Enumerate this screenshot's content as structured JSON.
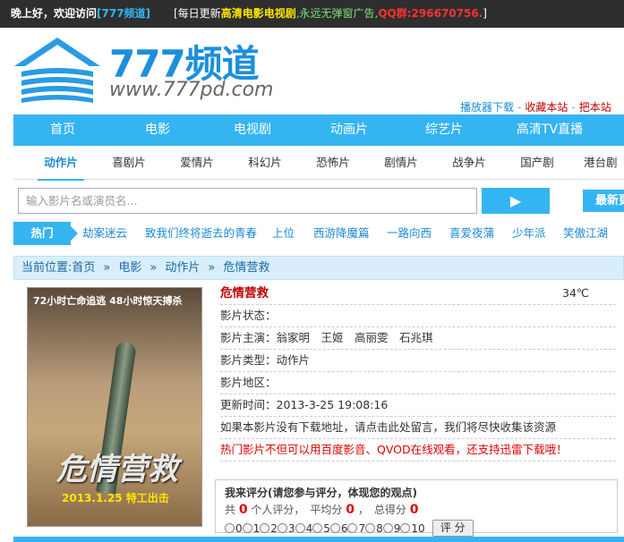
{
  "topbar": {
    "greeting": "晚上好，欢迎访问",
    "site_tag": "[777频道]",
    "ticker_open": "[每日更新",
    "ticker_hl1": "高清电影电视剧",
    "ticker_mid": ",永远无弹窗广告,",
    "ticker_qq": "QQ群:296670756.",
    "ticker_close": "]"
  },
  "logo": {
    "brand": "777频道",
    "url": "www.777pd.com"
  },
  "toplinks": {
    "player": "播放器下载",
    "sep": "-",
    "favorite": "收藏本站",
    "homepage": "把本站"
  },
  "main_nav": [
    "首页",
    "电影",
    "电视剧",
    "动画片",
    "综艺片",
    "高清TV直播"
  ],
  "sub_nav": [
    "动作片",
    "喜剧片",
    "爱情片",
    "科幻片",
    "恐怖片",
    "剧情片",
    "战争片",
    "国产剧",
    "港台剧"
  ],
  "search": {
    "placeholder": "输入影片名或演员名...",
    "button_icon": "▶",
    "latest": "最新更新"
  },
  "hot": {
    "label": "热门",
    "keywords": [
      "劫案迷云",
      "致我们终将逝去的青春",
      "上位",
      "西游降魔篇",
      "一路向西",
      "喜爱夜蒲",
      "少年派",
      "笑傲江湖"
    ]
  },
  "breadcrumb": {
    "prefix": "当前位置:",
    "home": "首页",
    "sep": "»",
    "cat1": "电影",
    "cat2": "动作片",
    "current": "危情营救"
  },
  "poster": {
    "top_text": "72小时亡命追逃 48小时惊天搏杀",
    "title": "危情营救",
    "date": "2013.1.25 特工出击"
  },
  "movie": {
    "title": "危情营救",
    "temperature": "34℃",
    "status": "影片状态：",
    "cast": "影片主演：翁家明　王姬　高丽雯　石兆琪",
    "genre": "影片类型：动作片",
    "region": "影片地区：",
    "updated": "更新时间：2013-3-25 19:08:16",
    "notice": "如果本影片没有下载地址，请点击此处留言，我们将尽快收集该资源",
    "promo": "热门影片不但可以用百度影音、QVOD在线观看，还支持迅雷下载哦！"
  },
  "rating": {
    "title": "我来评分(请您参与评分，体现您的观点)",
    "total_prefix": "共",
    "total": "0",
    "total_suffix": "个人评分，　平均分",
    "average": "0",
    "score_label": "，　总得分",
    "score": "0",
    "options": [
      "0",
      "1",
      "2",
      "3",
      "4",
      "5",
      "6",
      "7",
      "8",
      "9",
      "10"
    ],
    "submit": "评 分"
  },
  "colors": {
    "accent": "#35b4f2",
    "red": "#c40000",
    "topbar": "#2e2e2e"
  }
}
